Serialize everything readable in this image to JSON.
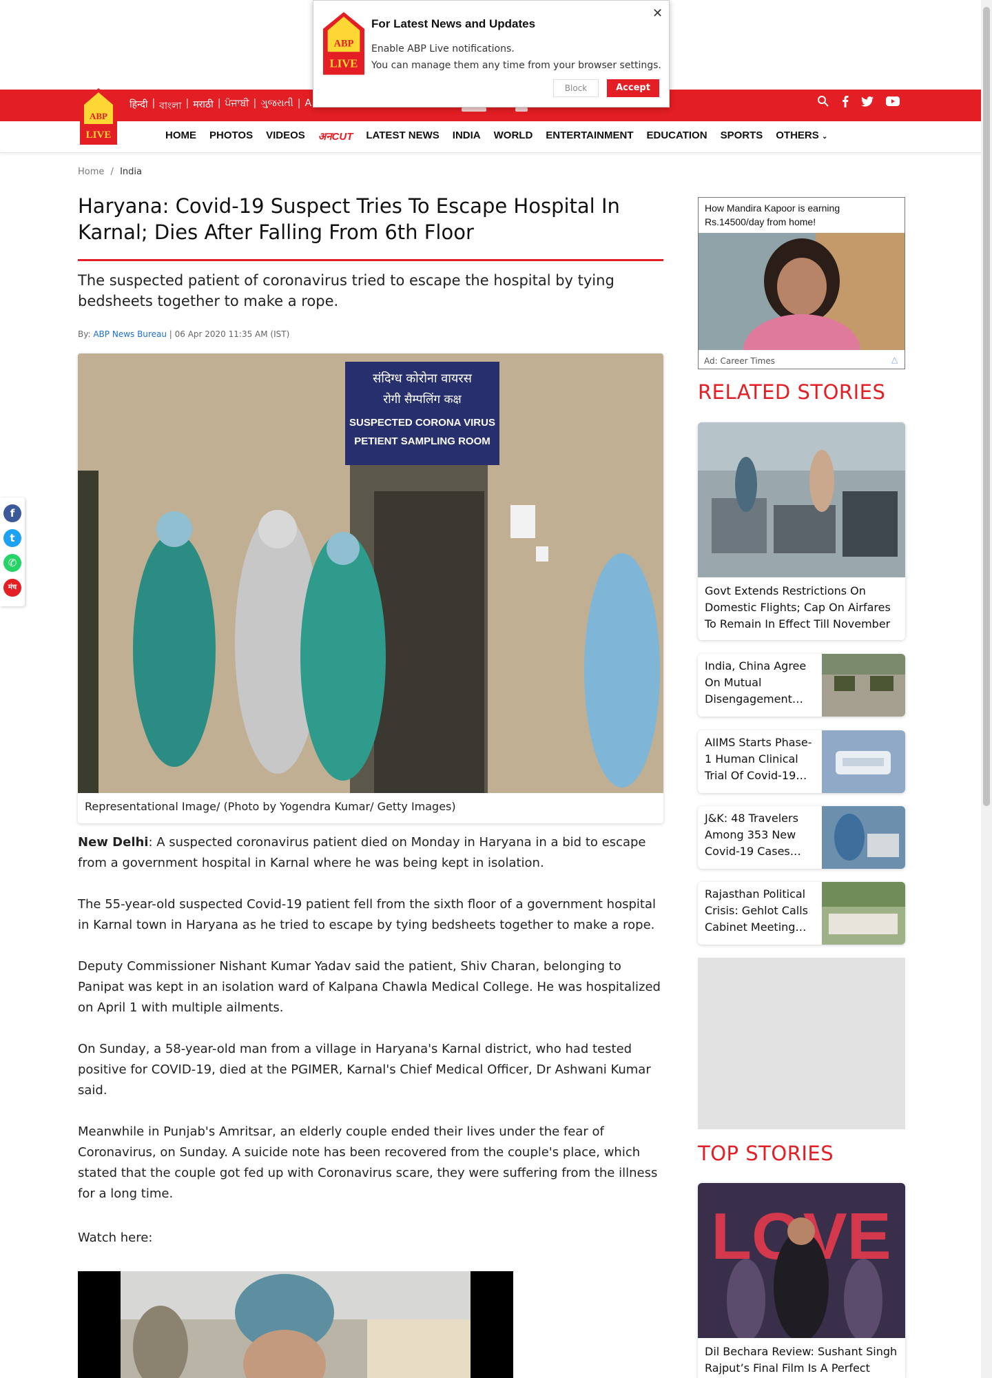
{
  "popup": {
    "title": "For Latest News and Updates",
    "line1": "Enable ABP Live notifications.",
    "line2": "You can manage them any time from your browser settings.",
    "close": "✕",
    "block": "Block",
    "accept": "Accept"
  },
  "logo": {
    "top": "ABP",
    "bottom": "LIVE"
  },
  "languages": [
    "हिन्दी",
    "বাংলা",
    "मराठी",
    "ਪੰਜਾਬੀ",
    "ગુજરાતી",
    "A"
  ],
  "nav": [
    "HOME",
    "PHOTOS",
    "VIDEOS",
    "अनCUT",
    "LATEST NEWS",
    "INDIA",
    "WORLD",
    "ENTERTAINMENT",
    "EDUCATION",
    "SPORTS",
    "OTHERS"
  ],
  "breadcrumb": {
    "home": "Home",
    "sep": "/",
    "current": "India"
  },
  "article": {
    "headline": "Haryana: Covid-19 Suspect Tries To Escape Hospital In Karnal; Dies After Falling From 6th Floor",
    "summary": "The suspected patient of coronavirus tried to escape the hospital by tying bedsheets together to make a rope.",
    "by_prefix": "By:",
    "author": "ABP News Bureau",
    "date": "| 06 Apr 2020 11:35 AM (IST)",
    "hero_sign1": "संदिग्ध कोरोना वायरस",
    "hero_sign2": "रोगी सैम्पलिंग कक्ष",
    "hero_sign3": "SUSPECTED CORONA VIRUS",
    "hero_sign4": "PETIENT SAMPLING ROOM",
    "caption": "Representational Image/ (Photo by Yogendra Kumar/ Getty Images)",
    "p1_lead": "New Delhi",
    "p1": ": A suspected coronavirus patient died on Monday in Haryana in a bid to escape from a government hospital in Karnal where he was being kept in isolation.",
    "p2": "The  55-year-old suspected Covid-19 patient fell from the sixth floor of a government hospital in Karnal town in Haryana as he tried to escape by tying bedsheets together to make a rope.",
    "p3": "Deputy Commissioner Nishant Kumar Yadav said the patient, Shiv Charan, belonging to Panipat was kept in an isolation ward of Kalpana Chawla Medical College. He was hospitalized on April 1 with multiple ailments.",
    "p4": "On Sunday, a 58-year-old man from a village in Haryana's Karnal district, who had tested positive for COVID-19, died at the PGIMER, Karnal's Chief Medical Officer, Dr Ashwani Kumar said.",
    "p5": "Meanwhile in Punjab's Amritsar, an elderly couple ended their lives under the fear of Coronavirus, on Sunday. A suicide note has been recovered from the couple's place, which stated that the couple got fed up with Coronavirus scare, they were suffering from the illness for a long time.",
    "p6": "Watch here:"
  },
  "share": {
    "mixed": "मंच"
  },
  "ad": {
    "title": "How Mandira Kapoor is earning Rs.14500/day from home!",
    "footer": "Ad: Career Times"
  },
  "related": {
    "heading": "RELATED STORIES",
    "featured": "Govt Extends Restrictions On Domestic Flights; Cap On Airfares To Remain In Effect Till November",
    "items": [
      "India, China Agree On Mutual Disengagement…",
      "AIIMS Starts Phase-1 Human Clinical Trial Of Covid-19…",
      "J&K: 48 Travelers Among 353 New Covid-19 Cases…",
      "Rajasthan Political Crisis: Gehlot Calls Cabinet Meeting…"
    ]
  },
  "top": {
    "heading": "TOP STORIES",
    "featured": "Dil Bechara Review: Sushant Singh Rajput’s Final Film Is A Perfect"
  },
  "colors": {
    "brand_red": "#e31e24",
    "link_blue": "#1c6ed1"
  }
}
